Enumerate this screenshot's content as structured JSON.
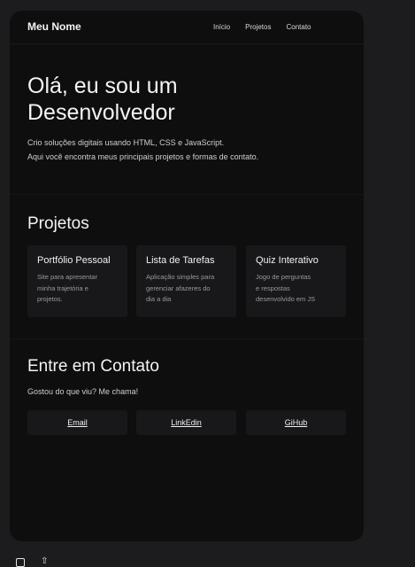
{
  "header": {
    "brand": "Meu Nome",
    "nav": [
      "Início",
      "Projetos",
      "Contato"
    ]
  },
  "hero": {
    "title_line1": "Olá, eu sou um",
    "title_line2": "Desenvolvedor",
    "text_line1": "Crio soluções digitais usando HTML, CSS e JavaScript.",
    "text_line2": "Aqui você encontra meus principais projetos e formas de contato."
  },
  "projects": {
    "title": "Projetos",
    "items": [
      {
        "title": "Portfólio Pessoal",
        "desc": [
          "Site para apresentar",
          "minha trajetória e",
          "projetos."
        ]
      },
      {
        "title": "Lista de Tarefas",
        "desc": [
          "Aplicação simples para",
          "gerenciar afazeres do",
          "dia a dia"
        ]
      },
      {
        "title": "Quiz Interativo",
        "desc": [
          "Jogo de perguntas",
          "e respostas",
          "desenvolvido em JS"
        ]
      }
    ]
  },
  "contact": {
    "title": "Entre em Contato",
    "subtitle": "Gostou do que viu? Me chama!",
    "buttons": [
      "Email",
      "LinkEdin",
      "GiHub"
    ]
  },
  "colors": {
    "page_bg": "#1c1c1e",
    "card_bg": "#0e0e0f",
    "tile_bg": "#18181a"
  },
  "icons": [
    "window-icon",
    "arrow-up-icon"
  ]
}
